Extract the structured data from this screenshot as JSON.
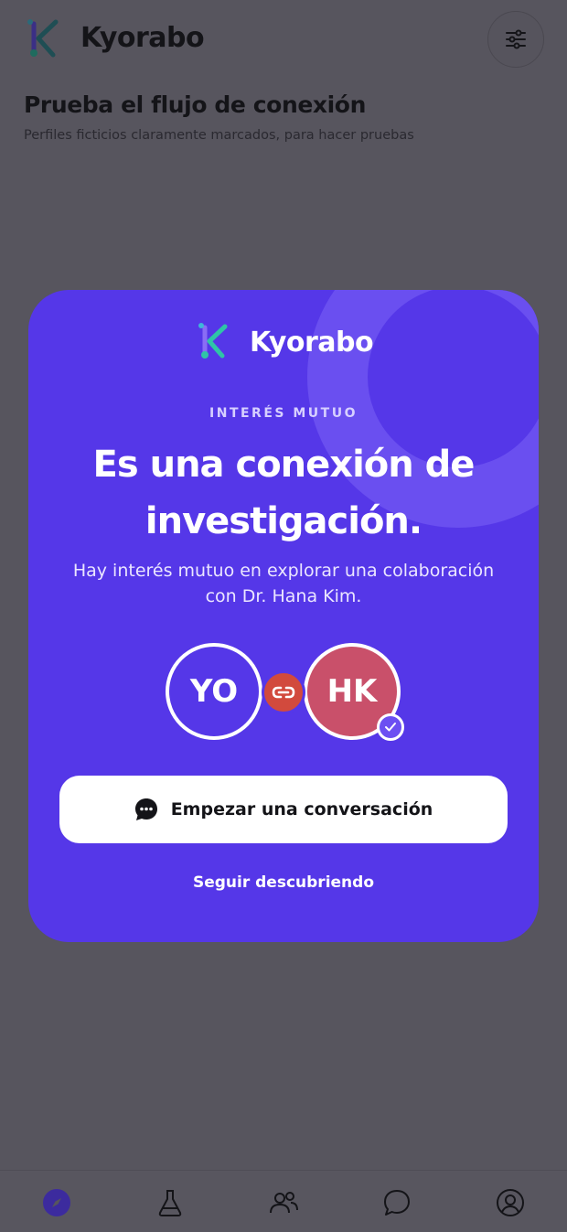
{
  "app": {
    "brand": "Kyorabo",
    "page_title": "Prueba el flujo de conexión",
    "page_subtitle": "Perfiles ficticios claramente marcados, para hacer pruebas"
  },
  "modal": {
    "brand": "Kyorabo",
    "eyebrow": "INTERÉS MUTUO",
    "headline": "Es una conexión de investigación.",
    "description": "Hay interés mutuo en explorar una colaboración con Dr. Hana Kim.",
    "avatar_me": "YO",
    "avatar_other": "HK",
    "primary_button": "Empezar una conversación",
    "secondary_link": "Seguir descubriendo"
  },
  "bottom_nav": [
    {
      "name": "discover",
      "icon": "compass-icon",
      "active": true
    },
    {
      "name": "lab",
      "icon": "flask-icon",
      "active": false
    },
    {
      "name": "people",
      "icon": "people-icon",
      "active": false
    },
    {
      "name": "chats",
      "icon": "chat-bubble-icon",
      "active": false
    },
    {
      "name": "profile",
      "icon": "user-circle-icon",
      "active": false
    }
  ],
  "colors": {
    "modal_bg": "#5537e8",
    "overlay_bg": "#57555e",
    "avatar_other": "#c9506a",
    "link_badge": "#d24a3d"
  }
}
